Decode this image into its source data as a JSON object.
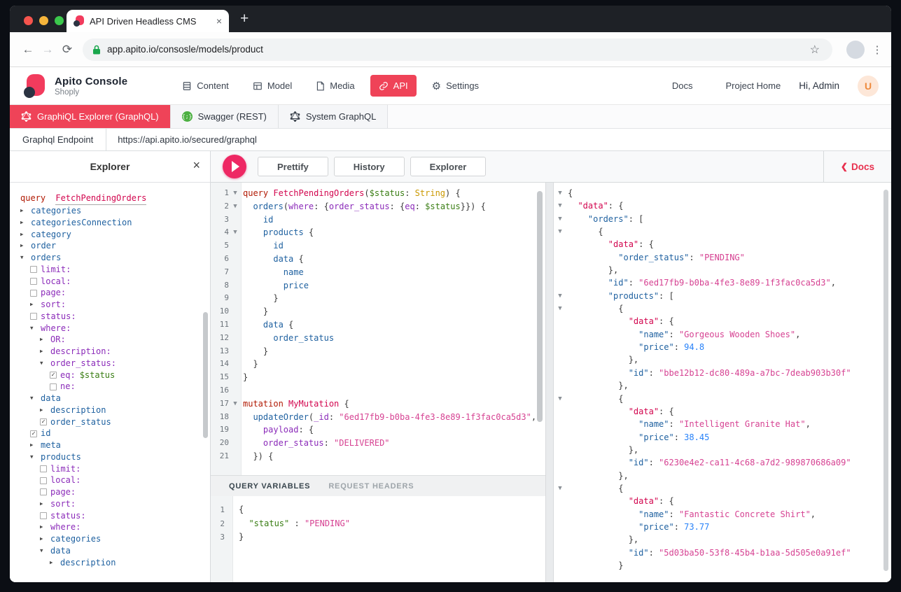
{
  "browser": {
    "tab_title": "API Driven Headless CMS",
    "tab_close": "×",
    "new_tab": "+",
    "url": "app.apito.io/consosle/models/product"
  },
  "header": {
    "app_name": "Apito Console",
    "project_name": "Shoply",
    "nav": [
      {
        "label": "Content",
        "icon": "content-icon",
        "active": false
      },
      {
        "label": "Model",
        "icon": "model-icon",
        "active": false
      },
      {
        "label": "Media",
        "icon": "media-icon",
        "active": false
      },
      {
        "label": "API",
        "icon": "api-link-icon",
        "active": true
      },
      {
        "label": "Settings",
        "icon": "gear-icon",
        "active": false
      }
    ],
    "right": {
      "docs": "Docs",
      "project_home": "Project Home",
      "greeting": "Hi, Admin",
      "avatar_initial": "U"
    }
  },
  "api_tabs": [
    {
      "label": "GraphiQL Explorer (GraphQL)",
      "icon": "graphql-icon",
      "active": true
    },
    {
      "label": "Swagger (REST)",
      "icon": "swagger-icon",
      "active": false
    },
    {
      "label": "System GraphQL",
      "icon": "graphql-icon",
      "active": false
    }
  ],
  "endpoint": {
    "label": "Graphql Endpoint",
    "url": "https://api.apito.io/secured/graphql"
  },
  "toolbar": {
    "prettify": "Prettify",
    "history": "History",
    "explorer": "Explorer",
    "docs": "Docs",
    "docs_chevron": "❮"
  },
  "explorer_panel": {
    "title": "Explorer",
    "close": "×",
    "query_keyword": "query",
    "query_name": "FetchPendingOrders",
    "tree": [
      {
        "indent": 0,
        "widget": "arrow-collapsed",
        "label": "categories",
        "kind": "field"
      },
      {
        "indent": 0,
        "widget": "arrow-collapsed",
        "label": "categoriesConnection",
        "kind": "field"
      },
      {
        "indent": 0,
        "widget": "arrow-collapsed",
        "label": "category",
        "kind": "field"
      },
      {
        "indent": 0,
        "widget": "arrow-collapsed",
        "label": "order",
        "kind": "field"
      },
      {
        "indent": 0,
        "widget": "arrow-expanded",
        "label": "orders",
        "kind": "field"
      },
      {
        "indent": 1,
        "widget": "checkbox",
        "label": "limit:",
        "kind": "arg"
      },
      {
        "indent": 1,
        "widget": "checkbox",
        "label": "local:",
        "kind": "arg"
      },
      {
        "indent": 1,
        "widget": "checkbox",
        "label": "page:",
        "kind": "arg"
      },
      {
        "indent": 1,
        "widget": "arrow-collapsed",
        "label": "sort:",
        "kind": "arg"
      },
      {
        "indent": 1,
        "widget": "checkbox",
        "label": "status:",
        "kind": "arg"
      },
      {
        "indent": 1,
        "widget": "arrow-expanded",
        "label": "where:",
        "kind": "arg"
      },
      {
        "indent": 2,
        "widget": "arrow-collapsed",
        "label": "OR:",
        "kind": "arg"
      },
      {
        "indent": 2,
        "widget": "arrow-collapsed",
        "label": "description:",
        "kind": "arg"
      },
      {
        "indent": 2,
        "widget": "arrow-expanded",
        "label": "order_status:",
        "kind": "arg"
      },
      {
        "indent": 3,
        "widget": "checkbox-checked",
        "label": "eq:",
        "kind": "arg",
        "value": "$status"
      },
      {
        "indent": 3,
        "widget": "checkbox",
        "label": "ne:",
        "kind": "arg"
      },
      {
        "indent": 1,
        "widget": "arrow-expanded",
        "label": "data",
        "kind": "field"
      },
      {
        "indent": 2,
        "widget": "arrow-collapsed",
        "label": "description",
        "kind": "field"
      },
      {
        "indent": 2,
        "widget": "checkbox-checked",
        "label": "order_status",
        "kind": "field"
      },
      {
        "indent": 1,
        "widget": "checkbox-checked",
        "label": "id",
        "kind": "field"
      },
      {
        "indent": 1,
        "widget": "arrow-collapsed",
        "label": "meta",
        "kind": "field"
      },
      {
        "indent": 1,
        "widget": "arrow-expanded",
        "label": "products",
        "kind": "field"
      },
      {
        "indent": 2,
        "widget": "checkbox",
        "label": "limit:",
        "kind": "arg"
      },
      {
        "indent": 2,
        "widget": "checkbox",
        "label": "local:",
        "kind": "arg"
      },
      {
        "indent": 2,
        "widget": "checkbox",
        "label": "page:",
        "kind": "arg"
      },
      {
        "indent": 2,
        "widget": "arrow-collapsed",
        "label": "sort:",
        "kind": "arg"
      },
      {
        "indent": 2,
        "widget": "checkbox",
        "label": "status:",
        "kind": "arg"
      },
      {
        "indent": 2,
        "widget": "arrow-collapsed",
        "label": "where:",
        "kind": "arg"
      },
      {
        "indent": 2,
        "widget": "arrow-collapsed",
        "label": "categories",
        "kind": "field"
      },
      {
        "indent": 2,
        "widget": "arrow-expanded",
        "label": "data",
        "kind": "field"
      },
      {
        "indent": 3,
        "widget": "arrow-collapsed",
        "label": "description",
        "kind": "field"
      }
    ]
  },
  "editor": {
    "lines": [
      {
        "n": 1,
        "fold": true,
        "tokens": [
          [
            "query",
            "kw"
          ],
          [
            " FetchPendingOrders",
            "def"
          ],
          [
            "(",
            "p"
          ],
          [
            "$status",
            "var"
          ],
          [
            ": ",
            "p"
          ],
          [
            "String",
            "atom"
          ],
          [
            ") {",
            "p"
          ]
        ]
      },
      {
        "n": 2,
        "fold": true,
        "tokens": [
          [
            "  orders",
            "prop"
          ],
          [
            "(",
            "p"
          ],
          [
            "where",
            "attr"
          ],
          [
            ": {",
            "p"
          ],
          [
            "order_status",
            "attr"
          ],
          [
            ": {",
            "p"
          ],
          [
            "eq",
            "attr"
          ],
          [
            ": ",
            "p"
          ],
          [
            "$status",
            "var"
          ],
          [
            "}}) {",
            "p"
          ]
        ]
      },
      {
        "n": 3,
        "fold": false,
        "tokens": [
          [
            "    id",
            "prop"
          ]
        ]
      },
      {
        "n": 4,
        "fold": true,
        "tokens": [
          [
            "    products",
            "prop"
          ],
          [
            " {",
            "p"
          ]
        ]
      },
      {
        "n": 5,
        "fold": false,
        "tokens": [
          [
            "      id",
            "prop"
          ]
        ]
      },
      {
        "n": 6,
        "fold": false,
        "tokens": [
          [
            "      data",
            "prop"
          ],
          [
            " {",
            "p"
          ]
        ]
      },
      {
        "n": 7,
        "fold": false,
        "tokens": [
          [
            "        name",
            "prop"
          ]
        ]
      },
      {
        "n": 8,
        "fold": false,
        "tokens": [
          [
            "        price",
            "prop"
          ]
        ]
      },
      {
        "n": 9,
        "fold": false,
        "tokens": [
          [
            "      }",
            "p"
          ]
        ]
      },
      {
        "n": 10,
        "fold": false,
        "tokens": [
          [
            "    }",
            "p"
          ]
        ]
      },
      {
        "n": 11,
        "fold": false,
        "tokens": [
          [
            "    data",
            "prop"
          ],
          [
            " {",
            "p"
          ]
        ]
      },
      {
        "n": 12,
        "fold": false,
        "tokens": [
          [
            "      order_status",
            "prop"
          ]
        ]
      },
      {
        "n": 13,
        "fold": false,
        "tokens": [
          [
            "    }",
            "p"
          ]
        ]
      },
      {
        "n": 14,
        "fold": false,
        "tokens": [
          [
            "  }",
            "p"
          ]
        ]
      },
      {
        "n": 15,
        "fold": false,
        "tokens": [
          [
            "}",
            "p"
          ]
        ]
      },
      {
        "n": 16,
        "fold": false,
        "tokens": []
      },
      {
        "n": 17,
        "fold": true,
        "tokens": [
          [
            "mutation",
            "kw"
          ],
          [
            " MyMutation",
            "def"
          ],
          [
            " {",
            "p"
          ]
        ]
      },
      {
        "n": 18,
        "fold": false,
        "tokens": [
          [
            "  updateOrder",
            "prop"
          ],
          [
            "(",
            "p"
          ],
          [
            "_id",
            "attr"
          ],
          [
            ": ",
            "p"
          ],
          [
            "\"6ed17fb9-b0ba-4fe3-8e89-1f3fac0ca5d3\"",
            "str"
          ],
          [
            ",",
            "p"
          ]
        ]
      },
      {
        "n": 19,
        "fold": false,
        "tokens": [
          [
            "    payload",
            "attr"
          ],
          [
            ": {",
            "p"
          ]
        ]
      },
      {
        "n": 20,
        "fold": false,
        "tokens": [
          [
            "    order_status",
            "attr"
          ],
          [
            ": ",
            "p"
          ],
          [
            "\"DELIVERED\"",
            "str"
          ]
        ]
      },
      {
        "n": 21,
        "fold": false,
        "tokens": [
          [
            "  }) {",
            "p"
          ]
        ]
      }
    ]
  },
  "variables_panel": {
    "tabs": [
      {
        "label": "QUERY VARIABLES",
        "active": true
      },
      {
        "label": "REQUEST HEADERS",
        "active": false
      }
    ],
    "lines": [
      {
        "n": 1,
        "tokens": [
          [
            "{",
            "p"
          ]
        ]
      },
      {
        "n": 2,
        "tokens": [
          [
            "  \"status\"",
            "var"
          ],
          [
            " : ",
            "p"
          ],
          [
            "\"PENDING\"",
            "str"
          ]
        ]
      },
      {
        "n": 3,
        "tokens": [
          [
            "}",
            "p"
          ]
        ]
      }
    ]
  },
  "results": {
    "lines": [
      {
        "fold": true,
        "tokens": [
          [
            "{",
            "p"
          ]
        ]
      },
      {
        "fold": true,
        "tokens": [
          [
            "  \"data\"",
            "def"
          ],
          [
            ": {",
            "p"
          ]
        ]
      },
      {
        "fold": true,
        "tokens": [
          [
            "    \"orders\"",
            "prop"
          ],
          [
            ": [",
            "p"
          ]
        ]
      },
      {
        "fold": true,
        "tokens": [
          [
            "      {",
            "p"
          ]
        ]
      },
      {
        "fold": false,
        "tokens": [
          [
            "        \"data\"",
            "def"
          ],
          [
            ": {",
            "p"
          ]
        ]
      },
      {
        "fold": false,
        "tokens": [
          [
            "          \"order_status\"",
            "prop"
          ],
          [
            ": ",
            "p"
          ],
          [
            "\"PENDING\"",
            "str"
          ]
        ]
      },
      {
        "fold": false,
        "tokens": [
          [
            "        },",
            "p"
          ]
        ]
      },
      {
        "fold": false,
        "tokens": [
          [
            "        \"id\"",
            "prop"
          ],
          [
            ": ",
            "p"
          ],
          [
            "\"6ed17fb9-b0ba-4fe3-8e89-1f3fac0ca5d3\"",
            "str"
          ],
          [
            ",",
            "p"
          ]
        ]
      },
      {
        "fold": true,
        "tokens": [
          [
            "        \"products\"",
            "prop"
          ],
          [
            ": [",
            "p"
          ]
        ]
      },
      {
        "fold": true,
        "tokens": [
          [
            "          {",
            "p"
          ]
        ]
      },
      {
        "fold": false,
        "tokens": [
          [
            "            \"data\"",
            "def"
          ],
          [
            ": {",
            "p"
          ]
        ]
      },
      {
        "fold": false,
        "tokens": [
          [
            "              \"name\"",
            "prop"
          ],
          [
            ": ",
            "p"
          ],
          [
            "\"Gorgeous Wooden Shoes\"",
            "str"
          ],
          [
            ",",
            "p"
          ]
        ]
      },
      {
        "fold": false,
        "tokens": [
          [
            "              \"price\"",
            "prop"
          ],
          [
            ": ",
            "p"
          ],
          [
            "94.8",
            "num"
          ]
        ]
      },
      {
        "fold": false,
        "tokens": [
          [
            "            },",
            "p"
          ]
        ]
      },
      {
        "fold": false,
        "tokens": [
          [
            "            \"id\"",
            "prop"
          ],
          [
            ": ",
            "p"
          ],
          [
            "\"bbe12b12-dc80-489a-a7bc-7deab903b30f\"",
            "str"
          ]
        ]
      },
      {
        "fold": false,
        "tokens": [
          [
            "          },",
            "p"
          ]
        ]
      },
      {
        "fold": true,
        "tokens": [
          [
            "          {",
            "p"
          ]
        ]
      },
      {
        "fold": false,
        "tokens": [
          [
            "            \"data\"",
            "def"
          ],
          [
            ": {",
            "p"
          ]
        ]
      },
      {
        "fold": false,
        "tokens": [
          [
            "              \"name\"",
            "prop"
          ],
          [
            ": ",
            "p"
          ],
          [
            "\"Intelligent Granite Hat\"",
            "str"
          ],
          [
            ",",
            "p"
          ]
        ]
      },
      {
        "fold": false,
        "tokens": [
          [
            "              \"price\"",
            "prop"
          ],
          [
            ": ",
            "p"
          ],
          [
            "38.45",
            "num"
          ]
        ]
      },
      {
        "fold": false,
        "tokens": [
          [
            "            },",
            "p"
          ]
        ]
      },
      {
        "fold": false,
        "tokens": [
          [
            "            \"id\"",
            "prop"
          ],
          [
            ": ",
            "p"
          ],
          [
            "\"6230e4e2-ca11-4c68-a7d2-989870686a09\"",
            "str"
          ]
        ]
      },
      {
        "fold": false,
        "tokens": [
          [
            "          },",
            "p"
          ]
        ]
      },
      {
        "fold": true,
        "tokens": [
          [
            "          {",
            "p"
          ]
        ]
      },
      {
        "fold": false,
        "tokens": [
          [
            "            \"data\"",
            "def"
          ],
          [
            ": {",
            "p"
          ]
        ]
      },
      {
        "fold": false,
        "tokens": [
          [
            "              \"name\"",
            "prop"
          ],
          [
            ": ",
            "p"
          ],
          [
            "\"Fantastic Concrete Shirt\"",
            "str"
          ],
          [
            ",",
            "p"
          ]
        ]
      },
      {
        "fold": false,
        "tokens": [
          [
            "              \"price\"",
            "prop"
          ],
          [
            ": ",
            "p"
          ],
          [
            "73.77",
            "num"
          ]
        ]
      },
      {
        "fold": false,
        "tokens": [
          [
            "            },",
            "p"
          ]
        ]
      },
      {
        "fold": false,
        "tokens": [
          [
            "            \"id\"",
            "prop"
          ],
          [
            ": ",
            "p"
          ],
          [
            "\"5d03ba50-53f8-45b4-b1aa-5d505e0a91ef\"",
            "str"
          ]
        ]
      },
      {
        "fold": false,
        "tokens": [
          [
            "          }",
            "p"
          ]
        ]
      }
    ]
  },
  "colors": {
    "accent": "#EF4358",
    "keyword": "#B11A04",
    "def": "#D2054E",
    "property": "#1F61A0",
    "attribute": "#8B2BB9",
    "variable": "#397D13",
    "type": "#CA9800",
    "string": "#D64292",
    "number": "#2882F9"
  }
}
